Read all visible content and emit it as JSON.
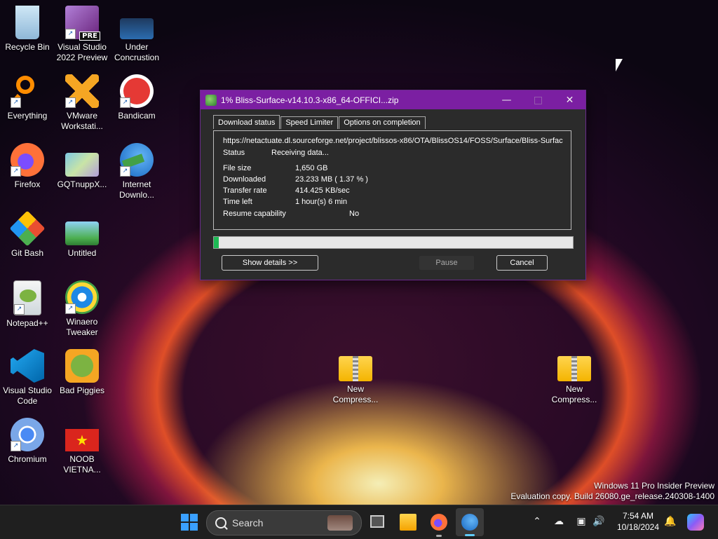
{
  "desktop": {
    "icons": [
      {
        "label": "Recycle Bin"
      },
      {
        "label": "Visual Studio 2022 Preview",
        "badge": "PRE"
      },
      {
        "label": "Under Concrustion"
      },
      {
        "label": "Everything"
      },
      {
        "label": "VMware Workstati..."
      },
      {
        "label": "Bandicam"
      },
      {
        "label": "Firefox"
      },
      {
        "label": "GQTnuppX..."
      },
      {
        "label": "Internet Downlo..."
      },
      {
        "label": "Git Bash"
      },
      {
        "label": "Untitled"
      },
      {
        "label": "Notepad++"
      },
      {
        "label": "Winaero Tweaker"
      },
      {
        "label": "Visual Studio Code"
      },
      {
        "label": "Bad Piggies"
      },
      {
        "label": "Chromium"
      },
      {
        "label": "NOOB VIETNA..."
      },
      {
        "label": "New Compress..."
      },
      {
        "label": "New Compress..."
      }
    ]
  },
  "dialog": {
    "title": "1% Bliss-Surface-v14.10.3-x86_64-OFFICI...zip",
    "tabs": [
      "Download status",
      "Speed Limiter",
      "Options on completion"
    ],
    "url": "https://netactuate.dl.sourceforge.net/project/blissos-x86/OTA/BlissOS14/FOSS/Surface/Bliss-Surfac",
    "status_label": "Status",
    "status_value": "Receiving data...",
    "fields": [
      {
        "key": "File size",
        "value": "1,650  GB"
      },
      {
        "key": "Downloaded",
        "value": "23.233  MB  ( 1.37 % )"
      },
      {
        "key": "Transfer rate",
        "value": "414.425  KB/sec"
      },
      {
        "key": "Time left",
        "value": "1 hour(s) 6 min"
      },
      {
        "key": "Resume capability",
        "value": "No"
      }
    ],
    "progress_percent": 1.37,
    "buttons": {
      "details": "Show details >>",
      "pause": "Pause",
      "cancel": "Cancel"
    }
  },
  "watermark": {
    "line1": "Windows 11 Pro Insider Preview",
    "line2": "Evaluation copy. Build 26080.ge_release.240308-1400"
  },
  "taskbar": {
    "search_placeholder": "Search",
    "time": "7:54 AM",
    "date": "10/18/2024"
  },
  "colors": {
    "titlebar": "#7b1fa2",
    "progress_fill": "#1db954"
  }
}
